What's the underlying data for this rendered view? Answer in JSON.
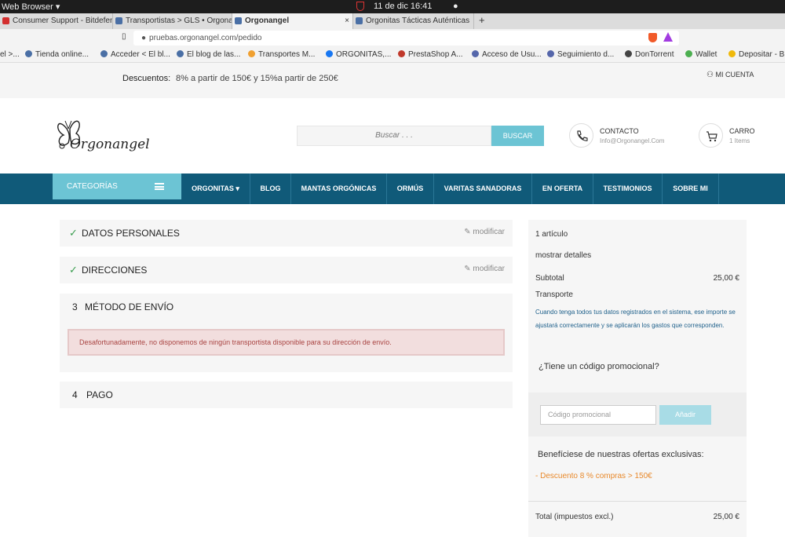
{
  "os": {
    "app": "Web Browser ▾",
    "clock": "11 de dic  16:41",
    "dot": "●"
  },
  "tabs": [
    {
      "label": "Consumer Support - Bitdefender",
      "icon_color": "#d32f2f"
    },
    {
      "label": "Transportistas > GLS • Orgonangel",
      "icon_color": "#4a6fa5"
    },
    {
      "label": "Orgonangel",
      "icon_color": "#4a6fa5",
      "close": "×"
    },
    {
      "label": "Orgonitas Tácticas Auténticas",
      "icon_color": "#4a6fa5"
    }
  ],
  "new_tab": "+",
  "url": "pruebas.orgonangel.com/pedido",
  "bookmarks": [
    {
      "label": "el >...",
      "color": "#888"
    },
    {
      "label": "Tienda online...",
      "color": "#4a6fa5"
    },
    {
      "label": "Acceder < El bl...",
      "color": "#4a6fa5"
    },
    {
      "label": "El blog de las...",
      "color": "#4a6fa5"
    },
    {
      "label": "Transportes M...",
      "color": "#f0a030"
    },
    {
      "label": "ORGONITAS,...",
      "color": "#1877f2"
    },
    {
      "label": "PrestaShop A...",
      "color": "#c0392b"
    },
    {
      "label": "Acceso de Usu...",
      "color": "#5566aa"
    },
    {
      "label": "Seguimiento d...",
      "color": "#5566aa"
    },
    {
      "label": "DonTorrent",
      "color": "#444"
    },
    {
      "label": "Wallet",
      "color": "#4caf50"
    },
    {
      "label": "Depositar - Bi",
      "color": "#f0b90b"
    }
  ],
  "promo": {
    "label": "Descuentos:",
    "text": "8% a partir de 150€ y 15%a partir de 250€",
    "account": "MI CUENTA"
  },
  "header": {
    "search_placeholder": "Buscar . . .",
    "search_button": "BUSCAR",
    "contact_title": "CONTACTO",
    "contact_email": "Info@Orgonangel.Com",
    "cart_title": "CARRO",
    "cart_items": "1 Items",
    "logo_text": "Orgonangel"
  },
  "nav": {
    "categories": "CATEGORÍAS",
    "items": [
      "ORGONITAS ▾",
      "BLOG",
      "MANTAS ORGÓNICAS",
      "ORMÚS",
      "VARITAS SANADORAS",
      "EN OFERTA",
      "TESTIMONIOS",
      "SOBRE MI"
    ]
  },
  "steps": [
    {
      "title": "DATOS PERSONALES",
      "status": "✓",
      "action": "modificar"
    },
    {
      "title": "DIRECCIONES",
      "status": "✓",
      "action": "modificar"
    },
    {
      "number": "3",
      "title": "MÉTODO DE ENVÍO"
    },
    {
      "number": "4",
      "title": "PAGO"
    }
  ],
  "alert": "Desafortunadamente, no disponemos de ningún transportista disponible para su dirección de envío.",
  "summary": {
    "count": "1 artículo",
    "details": "mostrar detalles",
    "subtotal_label": "Subtotal",
    "subtotal_value": "25,00 €",
    "shipping_label": "Transporte",
    "note": "Cuando tenga todos tus datos registrados en el sistema, ese importe se ajustará correctamente y se aplicarán los gastos que corresponden.",
    "promo_question": "¿Tiene un código promocional?",
    "promo_placeholder": "Código promocional",
    "apply_button": "Añadir",
    "benefit": "Benefíciese de nuestras ofertas exclusivas:",
    "offer": "- Descuento 8 % compras > 150€",
    "total_label": "Total (impuestos excl.)",
    "total_value": "25,00 €"
  }
}
